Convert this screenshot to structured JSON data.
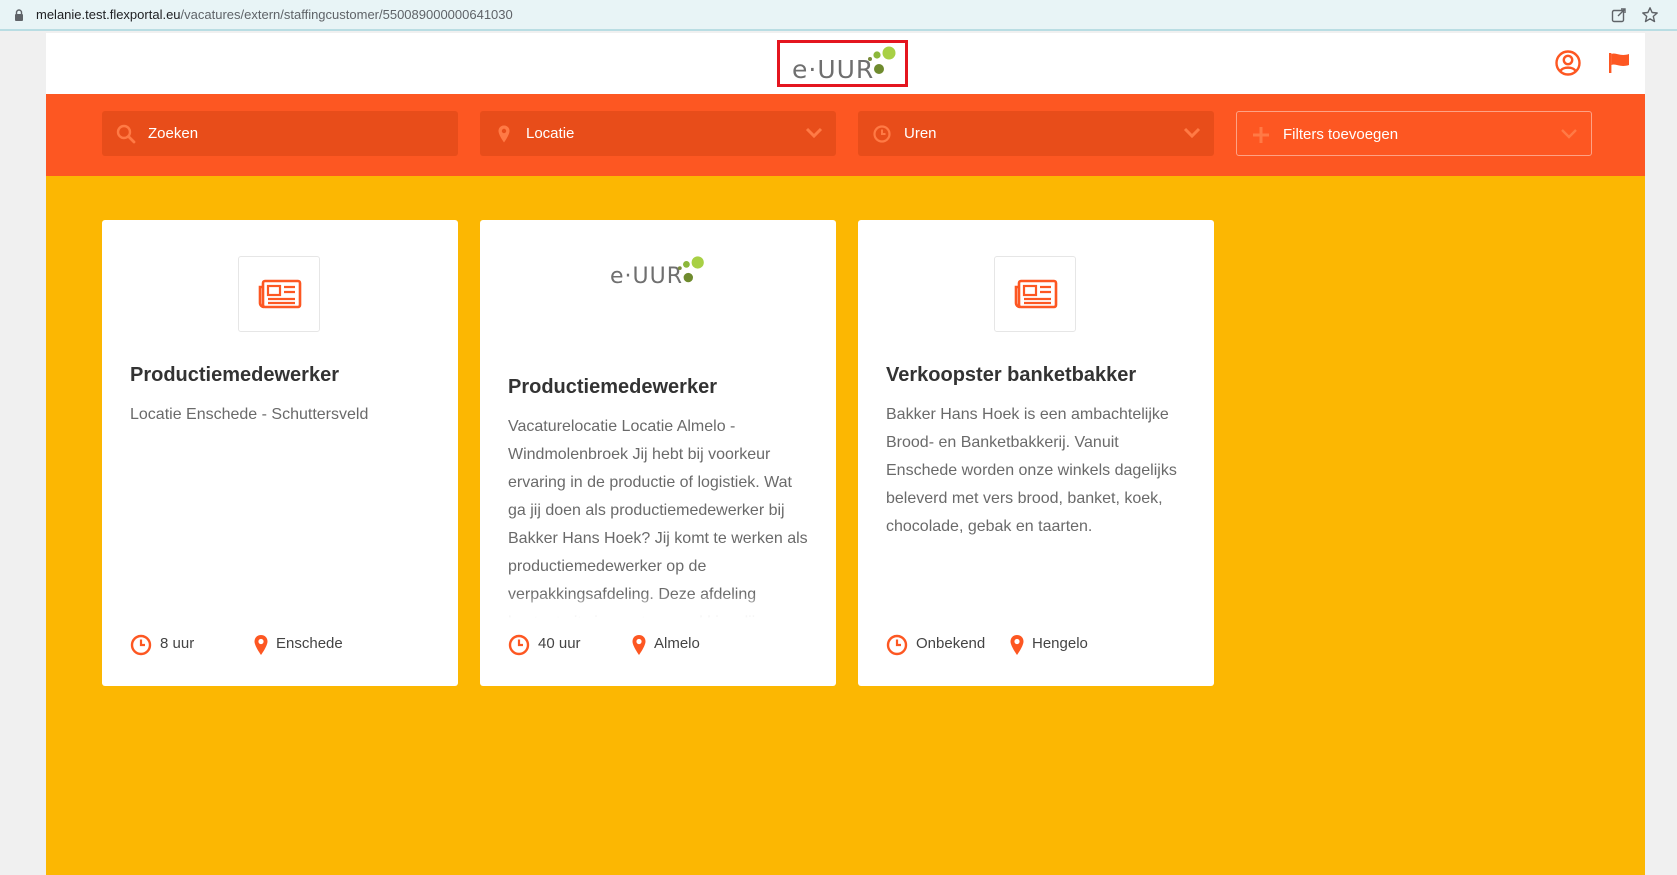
{
  "browser": {
    "url_host": "melanie.test.flexportal.eu",
    "url_path": "/vacatures/extern/staffingcustomer/550089000000641030"
  },
  "header": {
    "logo_text": "e·UUR"
  },
  "filters": [
    {
      "label": "Zoeken",
      "icon": "search-icon"
    },
    {
      "label": "Locatie",
      "icon": "location-pin-icon"
    },
    {
      "label": "Uren",
      "icon": "clock-icon"
    },
    {
      "label": "Filters toevoegen",
      "icon": "plus-icon"
    }
  ],
  "cards": [
    {
      "title": "Productiemedewerker",
      "description": "Locatie Enschede - Schuttersveld",
      "hours": "8 uur",
      "location": "Enschede",
      "image": "newspaper-icon"
    },
    {
      "title": "Productiemedewerker",
      "description": "Vacaturelocatie Locatie Almelo - Windmolenbroek Jij hebt bij voorkeur ervaring in de productie of logistiek. Wat ga jij doen als productiemedewerker bij Bakker Hans Hoek? Jij komt te werken als productiemedewerker op de verpakkingsafdeling. Deze afdeling bestaat uit vier vaste verpakkingslijnen",
      "hours": "40 uur",
      "location": "Almelo",
      "image": "e·UUR"
    },
    {
      "title": "Verkoopster banketbakker",
      "description": "Bakker Hans Hoek is een ambachtelijke Brood- en Banketbakkerij. Vanuit Enschede worden onze winkels dagelijks beleverd met vers brood, banket, koek, chocolade, gebak en taarten.",
      "hours": "Onbekend",
      "location": "Hengelo",
      "image": "newspaper-icon"
    }
  ],
  "colors": {
    "accent": "#fd5722",
    "background": "#fcb702",
    "logo_green": "#8cb83a"
  }
}
